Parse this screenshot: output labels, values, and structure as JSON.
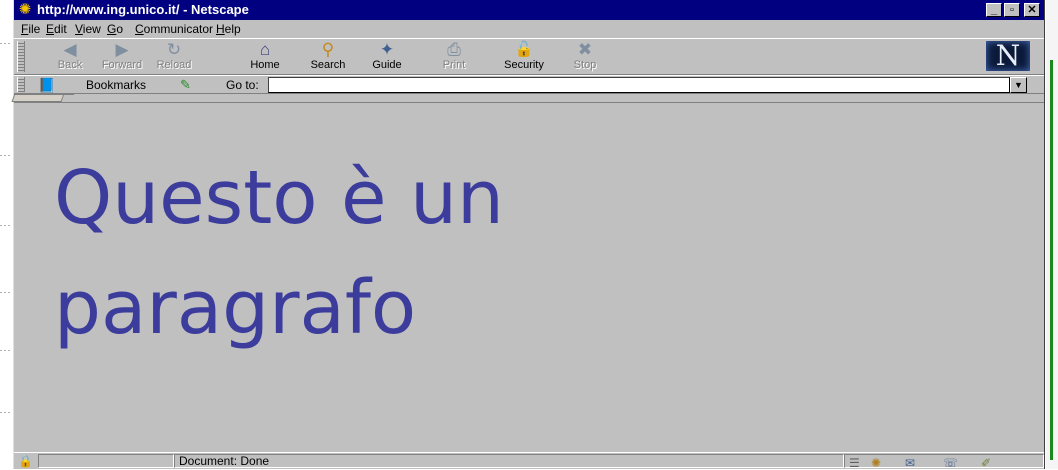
{
  "window": {
    "title": "http://www.ing.unico.it/ - Netscape",
    "controls": {
      "minimize": "_",
      "maximize": "▫",
      "close": "✕"
    }
  },
  "menu": {
    "items": [
      {
        "label": "File",
        "key": "F"
      },
      {
        "label": "Edit",
        "key": "E"
      },
      {
        "label": "View",
        "key": "V"
      },
      {
        "label": "Go",
        "key": "G"
      },
      {
        "label": "Communicator",
        "key": "C"
      },
      {
        "label": "Help",
        "key": "H"
      }
    ]
  },
  "toolbar": {
    "buttons": [
      {
        "label": "Back",
        "icon": "back-arrow-icon",
        "glyph": "◀",
        "enabled": false
      },
      {
        "label": "Forward",
        "icon": "forward-arrow-icon",
        "glyph": "▶",
        "enabled": false
      },
      {
        "label": "Reload",
        "icon": "reload-icon",
        "glyph": "↻",
        "enabled": false
      },
      {
        "label": "Home",
        "icon": "home-icon",
        "glyph": "⌂",
        "enabled": true
      },
      {
        "label": "Search",
        "icon": "search-icon",
        "glyph": "⚲",
        "enabled": true
      },
      {
        "label": "Guide",
        "icon": "guide-icon",
        "glyph": "✦",
        "enabled": true
      },
      {
        "label": "Print",
        "icon": "print-icon",
        "glyph": "⎙",
        "enabled": false
      },
      {
        "label": "Security",
        "icon": "lock-icon",
        "glyph": "🔓",
        "enabled": true
      },
      {
        "label": "Stop",
        "icon": "stop-icon",
        "glyph": "✖",
        "enabled": false
      }
    ],
    "logo": "N"
  },
  "location": {
    "bookmarks_label": "Bookmarks",
    "goto_label": "Go to:",
    "url_value": ""
  },
  "content": {
    "paragraph": "Questo è un paragrafo",
    "text_color": "#3c3c9c",
    "background_color": "#c0c0c0"
  },
  "status": {
    "text": "Document: Done"
  },
  "colors": {
    "titlebar": "#000080",
    "chrome": "#c0c0c0"
  }
}
